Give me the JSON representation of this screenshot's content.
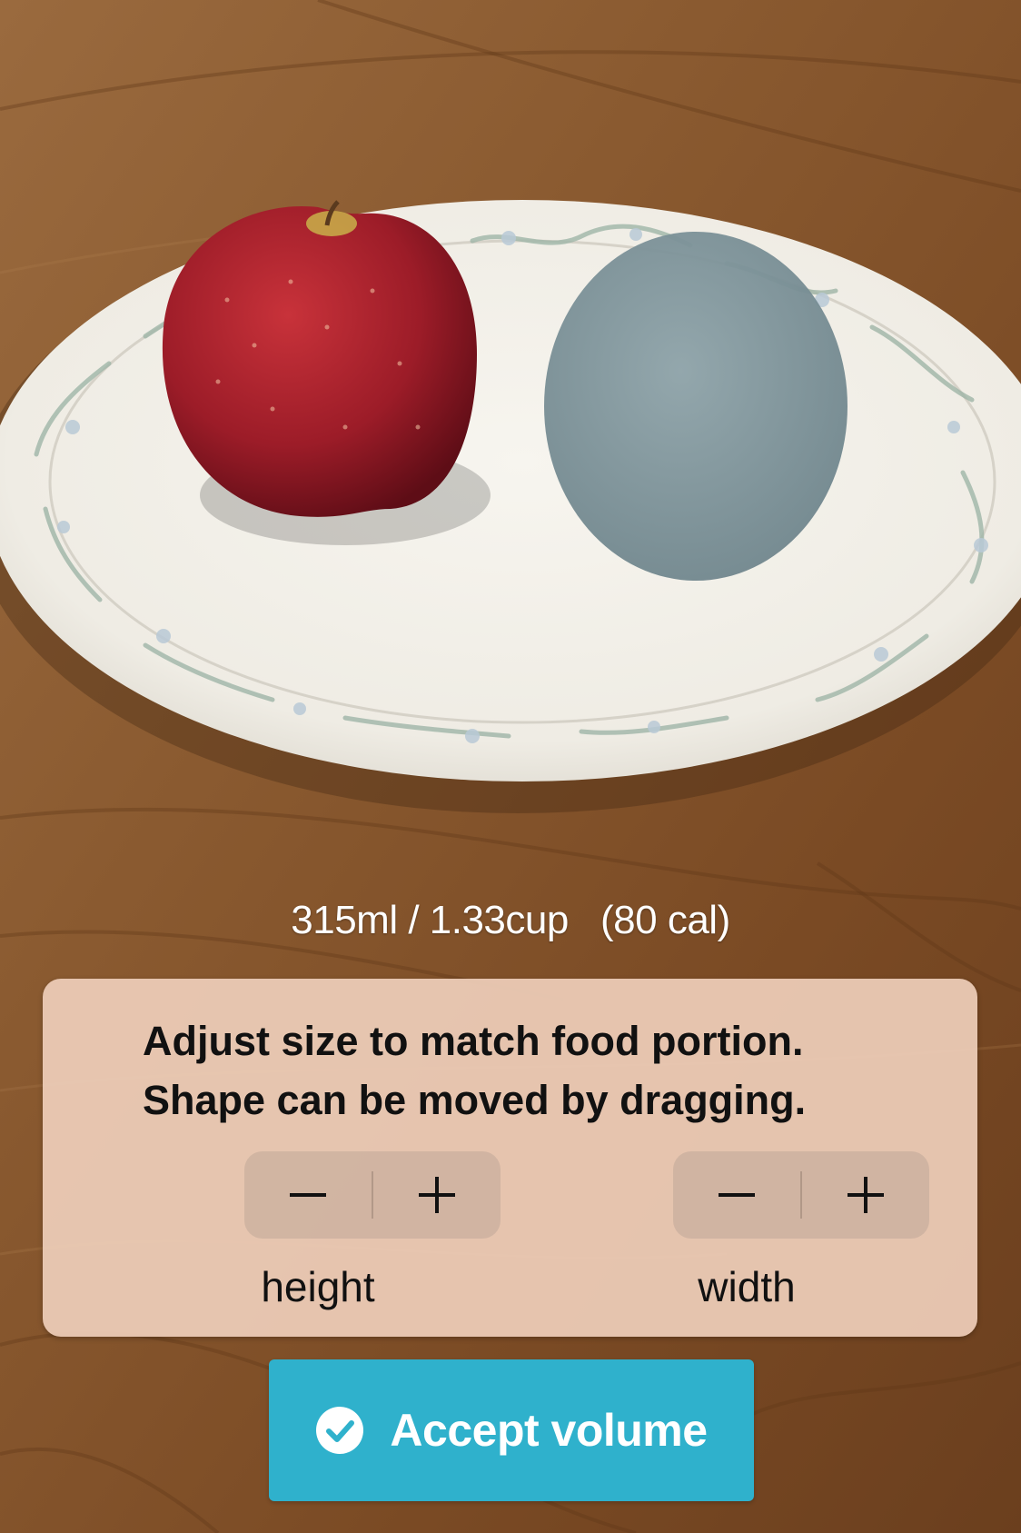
{
  "volume": {
    "text": "315ml / 1.33cup   (80 cal)"
  },
  "panel": {
    "line1": "Adjust size to match food portion.",
    "line2": "Shape can be moved by dragging.",
    "height_label": "height",
    "width_label": "width",
    "decrement_icon": "minus-icon",
    "increment_icon": "plus-icon"
  },
  "accept": {
    "label": "Accept volume",
    "icon": "checkmark-circle-icon"
  },
  "colors": {
    "accent": "#2fb1cc",
    "panel": "#eecdb9",
    "overlay_shape": "#7f959b"
  }
}
